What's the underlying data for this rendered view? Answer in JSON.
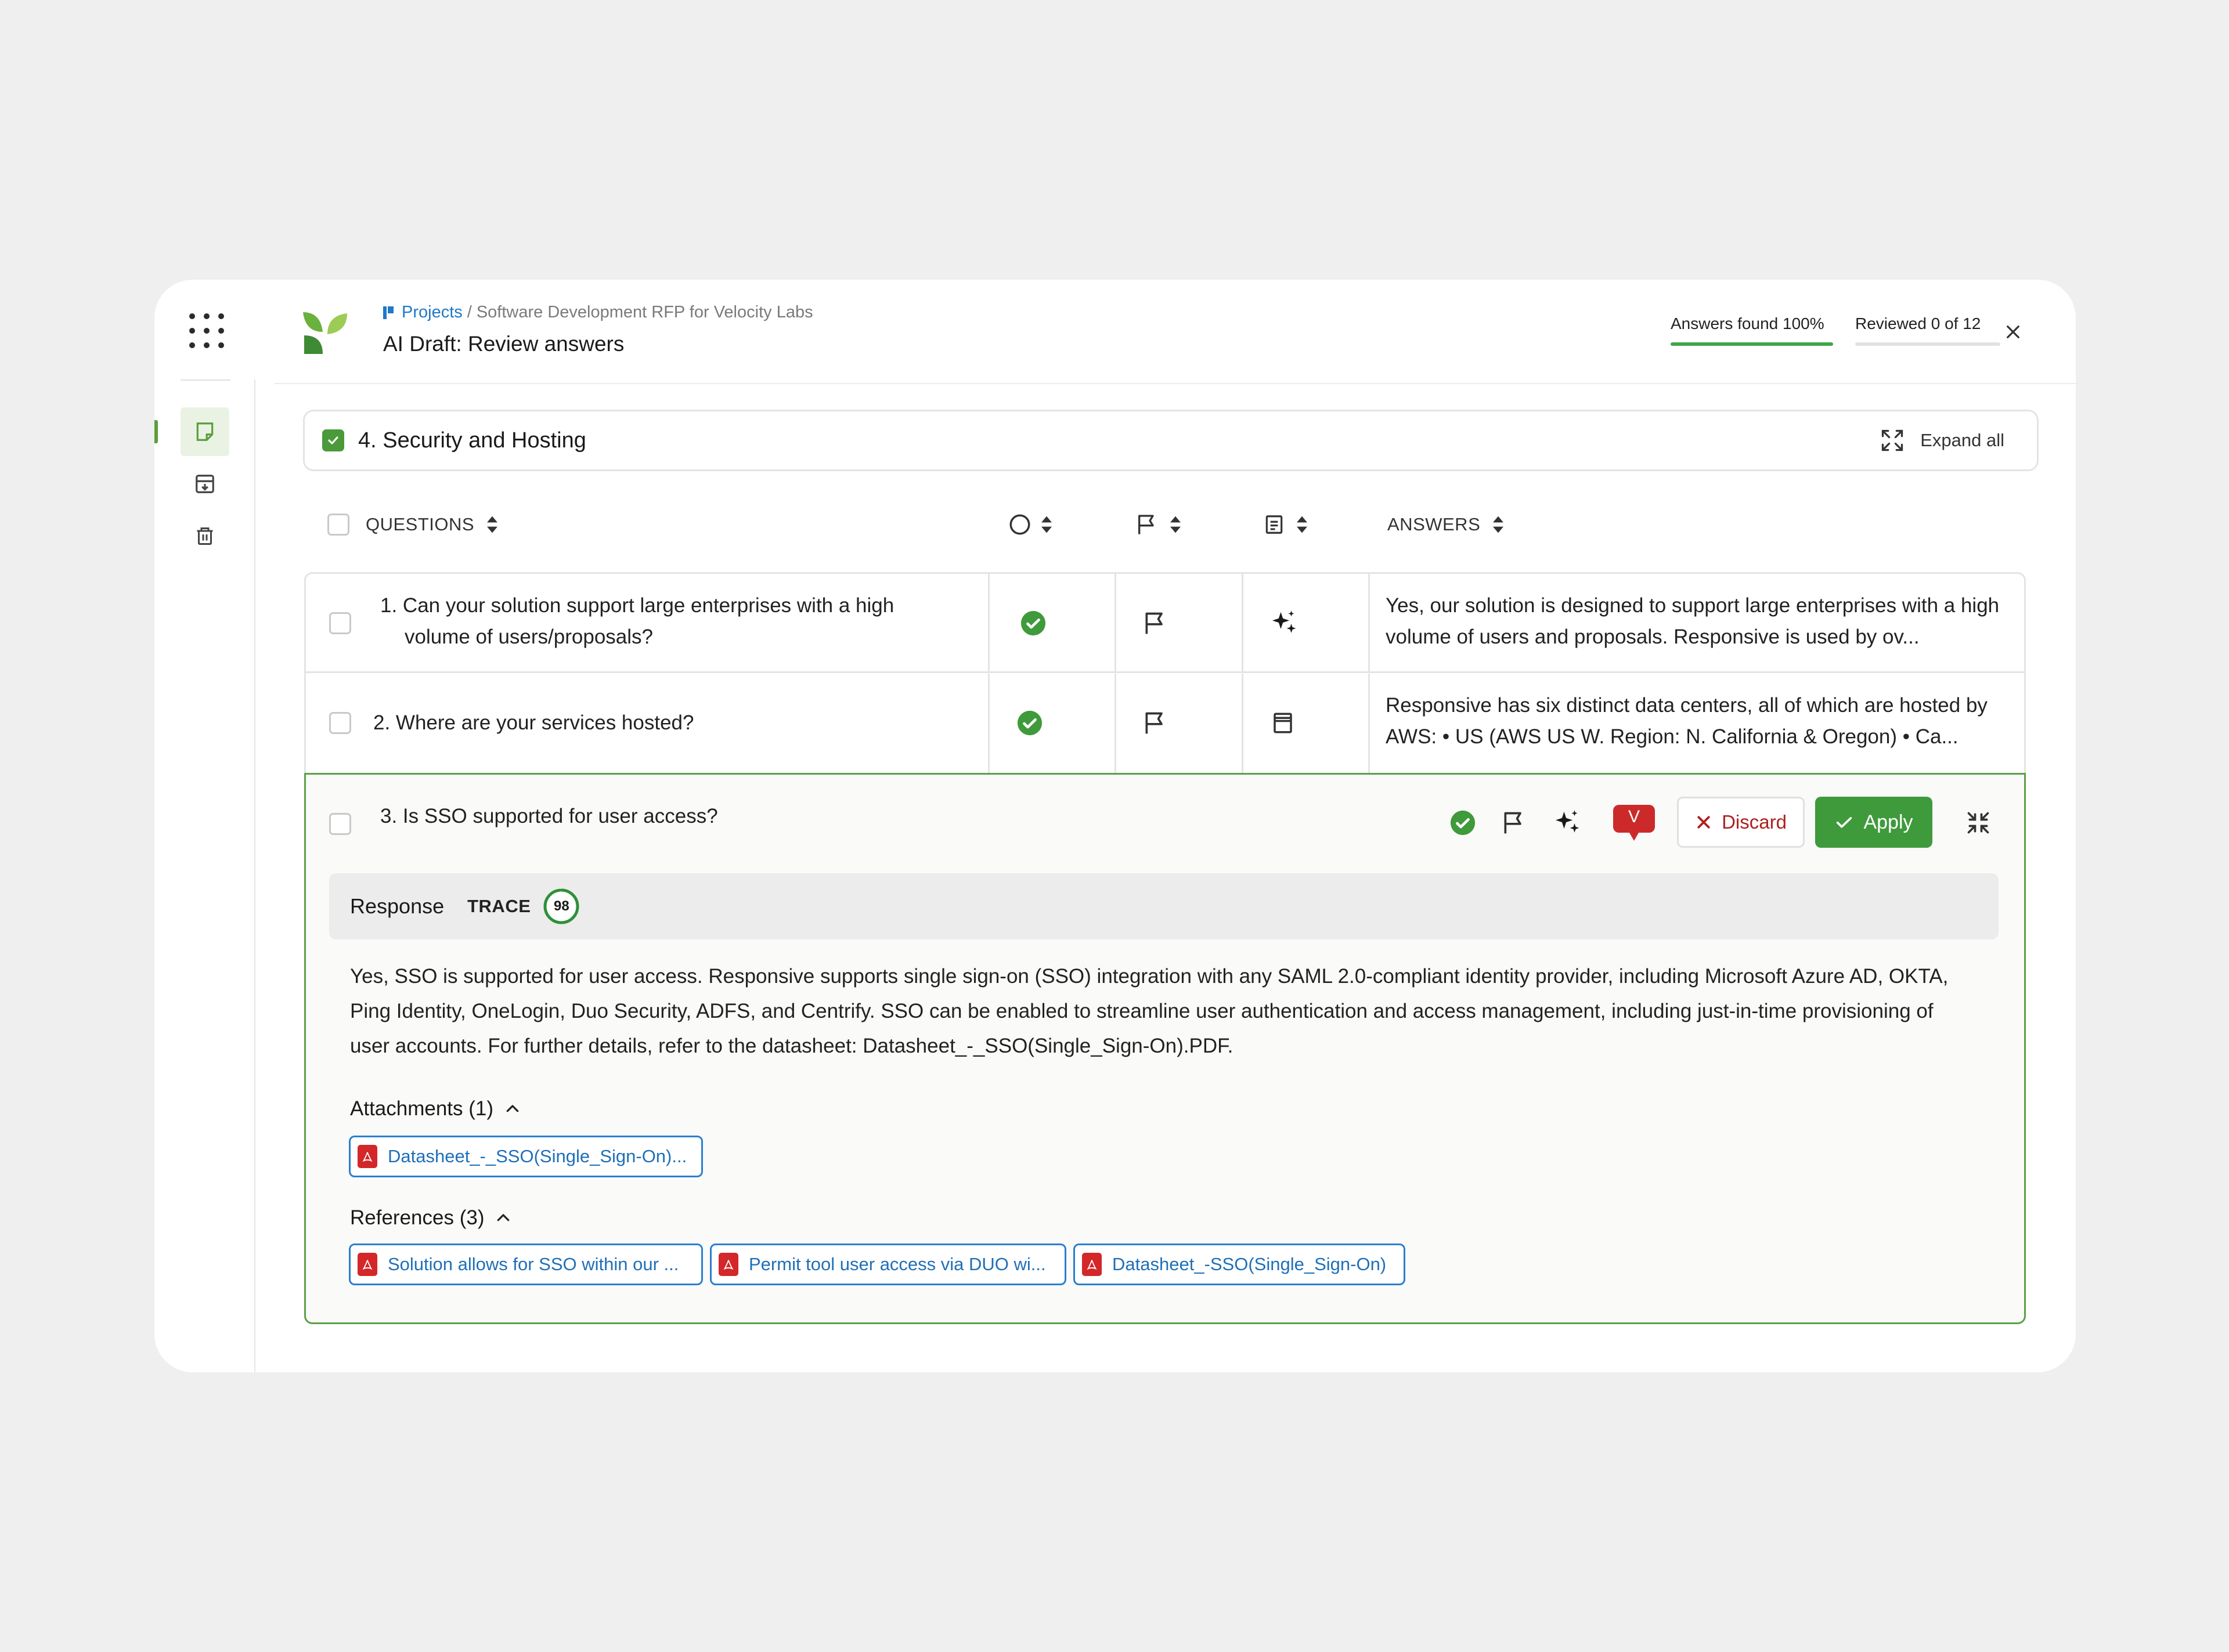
{
  "header": {
    "breadcrumb_root": "Projects",
    "breadcrumb_separator": "/",
    "breadcrumb_current": "Software Development RFP for Velocity Labs",
    "title": "AI Draft: Review answers",
    "answers_found": "Answers found 100%",
    "answers_found_fraction": 1.0,
    "reviewed": "Reviewed 0 of 12",
    "reviewed_fraction": 0.0
  },
  "section": {
    "title": "4. Security and Hosting",
    "expand_all": "Expand all"
  },
  "columns": {
    "questions": "QUESTIONS",
    "answers": "ANSWERS"
  },
  "rows": [
    {
      "question": "1. Can your solution support large enterprises with a high volume of users/proposals?",
      "answer": "Yes, our solution is designed to support large enterprises with a high volume of users and proposals. Responsive is used by ov..."
    },
    {
      "question": "2. Where are your services hosted?",
      "answer": "Responsive has six distinct data centers, all of which are hosted by AWS: • US (AWS US W. Region: N. California & Oregon) • Ca..."
    }
  ],
  "expanded": {
    "question": "3. Is SSO supported for user access?",
    "avatar_initial": "V",
    "discard": "Discard",
    "apply": "Apply",
    "response_label": "Response",
    "trace_label": "TRACE",
    "trace_score": "98",
    "trace_fraction": 0.98,
    "response_text": "Yes, SSO is supported for user access. Responsive supports single sign-on (SSO) integration with any SAML 2.0-compliant identity provider, including Microsoft Azure AD, OKTA, Ping Identity, OneLogin, Duo Security, ADFS, and Centrify. SSO can be enabled to streamline user authentication and access management, including just-in-time provisioning of user accounts. For further details, refer to the datasheet: Datasheet_-_SSO(Single_Sign-On).PDF.",
    "attachments_label": "Attachments (1)",
    "attachments": [
      "Datasheet_-_SSO(Single_Sign-On)..."
    ],
    "references_label": "References (3)",
    "references": [
      "Solution allows for SSO within our ...",
      "Permit tool user access via DUO wi...",
      "Datasheet_-SSO(Single_Sign-On)"
    ]
  },
  "colors": {
    "brand_green": "#5a9e3c",
    "success_green": "#4a9a3a",
    "link_blue": "#1f78c8",
    "danger_red": "#d3272a"
  },
  "icons": {
    "app_grid": "grid-icon",
    "sidebar": [
      "note-icon",
      "archive-icon",
      "trash-icon"
    ],
    "close": "close-icon",
    "status": "check-circle-icon",
    "flag": "flag-icon",
    "ai": "sparkle-icon",
    "document": "document-icon",
    "collapse": "collapse-icon",
    "expand": "expand-icon"
  }
}
